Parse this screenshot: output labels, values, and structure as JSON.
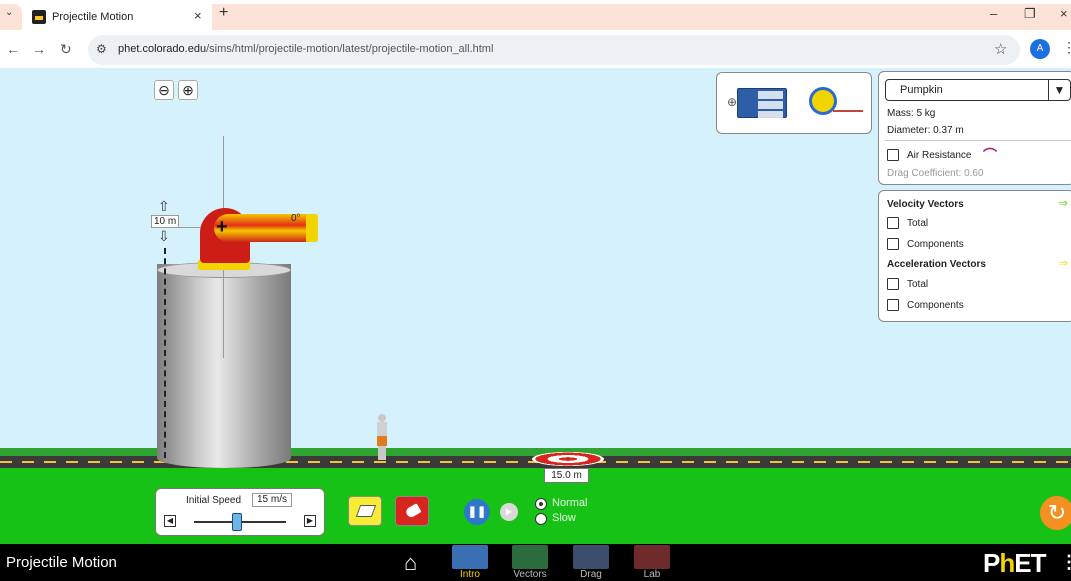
{
  "browser": {
    "tab_title": "Projectile Motion",
    "tab_close": "×",
    "new_tab": "+",
    "url_host": "phet.colorado.edu",
    "url_path": "/sims/html/projectile-motion/latest/projectile-motion_all.html",
    "avatar_letter": "A",
    "win_min": "–",
    "win_restore": "❐",
    "win_close": "×"
  },
  "sim": {
    "zoom_out": "⊖",
    "zoom_in": "⊕",
    "height_label": "10 m",
    "angle_label": "0°",
    "target_distance": "15.0 m",
    "initial_speed_label": "Initial Speed",
    "initial_speed_value": "15 m/s",
    "speed_slider_level": 0.47,
    "radio_normal": "Normal",
    "radio_slow": "Slow",
    "selected_speed_mode": "Normal"
  },
  "panel": {
    "projectile": "Pumpkin",
    "mass": "Mass: 5 kg",
    "diameter": "Diameter: 0.37 m",
    "air_resistance": "Air Resistance",
    "drag_coefficient": "Drag Coefficient: 0.60",
    "velocity_vectors": "Velocity Vectors",
    "velocity_total": "Total",
    "velocity_components": "Components",
    "acceleration_vectors": "Acceleration Vectors",
    "acceleration_total": "Total",
    "acceleration_components": "Components"
  },
  "navbar": {
    "sim_title": "Projectile Motion",
    "screens": [
      {
        "label": "Intro",
        "active": true,
        "color": "#3b6fb3"
      },
      {
        "label": "Vectors",
        "active": false,
        "color": "#2c6b3e"
      },
      {
        "label": "Drag",
        "active": false,
        "color": "#3c4e6b"
      },
      {
        "label": "Lab",
        "active": false,
        "color": "#6f2b2b"
      }
    ],
    "logo_p": "P",
    "logo_h": "h",
    "logo_et": "ET"
  },
  "colors": {
    "sky": "#d5f1fb",
    "grass": "#17c217",
    "accent_velocity": "#6fd82a",
    "accent_acceleration": "#e9e63b",
    "air_resistance_icon": "#a0207a"
  }
}
